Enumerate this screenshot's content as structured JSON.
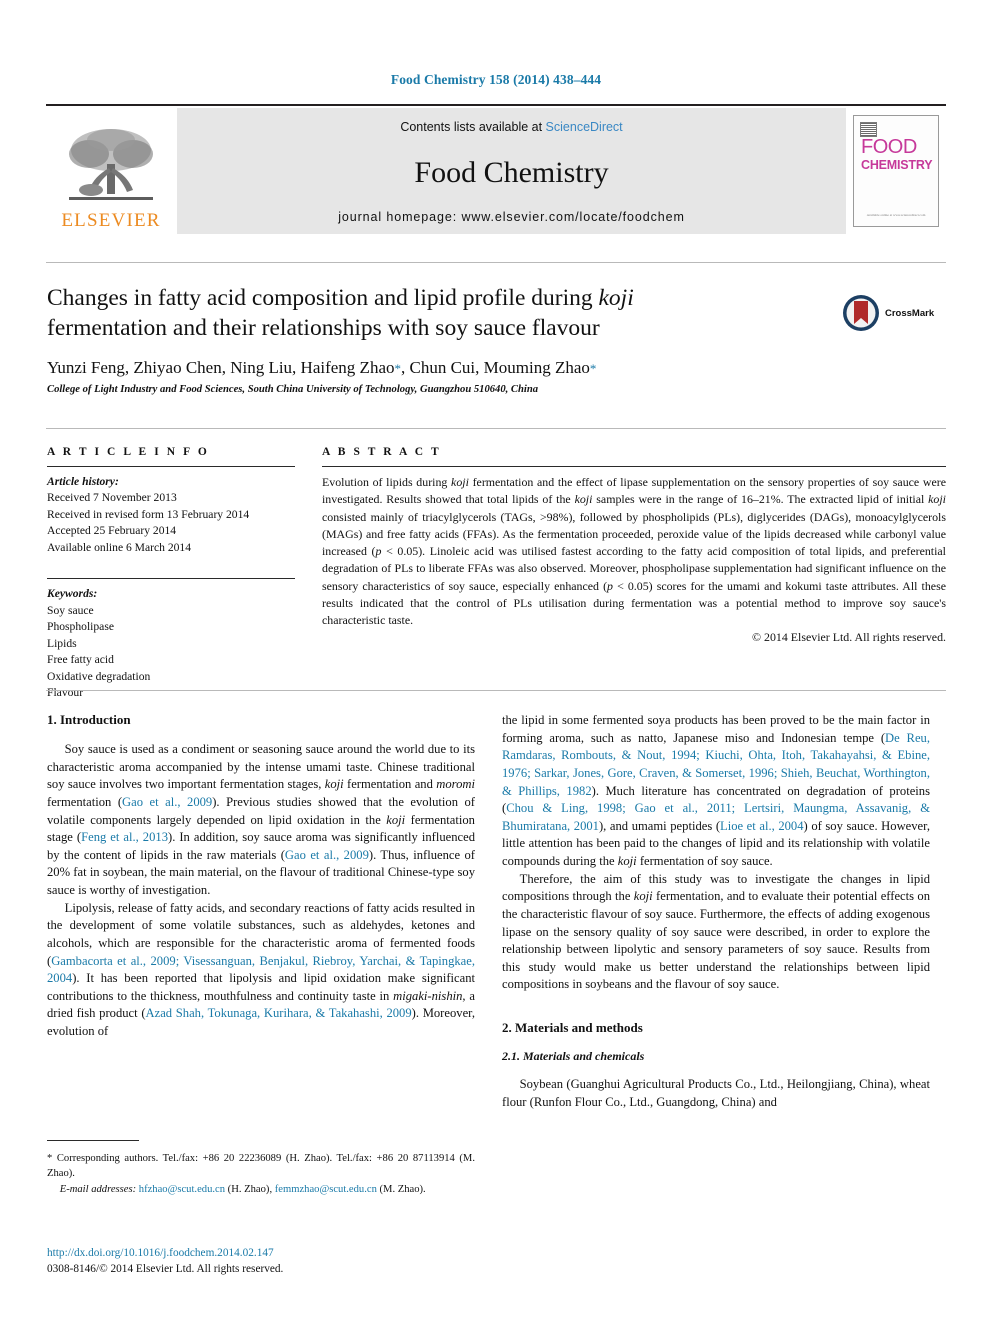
{
  "running_head": "Food Chemistry 158 (2014) 438–444",
  "masthead": {
    "contents_prefix": "Contents lists available at ",
    "sciencedirect": "ScienceDirect",
    "journal_title": "Food Chemistry",
    "homepage": "journal homepage: www.elsevier.com/locate/foodchem",
    "publisher_name": "ELSEVIER",
    "cover": {
      "line1": "FOOD",
      "line2": "CHEMISTRY",
      "footer": "Available online at www.sciencedirect.com"
    },
    "colors": {
      "link": "#3a88c4",
      "elsevier_orange": "#ec8b22",
      "cover_magenta": "#c6399a",
      "band_grey": "#e6e6e6"
    }
  },
  "article": {
    "title_line1": "Changes in fatty acid composition and lipid profile during ",
    "title_italic1": "koji",
    "title_line2": "fermentation and their relationships with soy sauce flavour",
    "authors": "Yunzi Feng, Zhiyao Chen, Ning Liu, Haifeng Zhao",
    "authors_cont": ", Chun Cui, Mouming Zhao",
    "corresponding_marker": "*",
    "affiliation": "College of Light Industry and Food Sciences, South China University of Technology, Guangzhou 510640, China",
    "crossmark_label": "CrossMark"
  },
  "article_info": {
    "heading": "A R T I C L E  I N F O",
    "history_label": "Article history:",
    "history": [
      "Received 7 November 2013",
      "Received in revised form 13 February 2014",
      "Accepted 25 February 2014",
      "Available online 6 March 2014"
    ],
    "keywords_label": "Keywords:",
    "keywords": [
      "Soy sauce",
      "Phospholipase",
      "Lipids",
      "Free fatty acid",
      "Oxidative degradation",
      "Flavour"
    ]
  },
  "abstract": {
    "heading": "A B S T R A C T",
    "part1": "Evolution of lipids during ",
    "italic1": "koji",
    "part2": " fermentation and the effect of lipase supplementation on the sensory properties of soy sauce were investigated. Results showed that total lipids of the ",
    "italic2": "koji",
    "part3": " samples were in the range of 16–21%. The extracted lipid of initial ",
    "italic3": "koji",
    "part4": " consisted mainly of triacylglycerols (TAGs, >98%), followed by phospholipids (PLs), diglycerides (DAGs), monoacylglycerols (MAGs) and free fatty acids (FFAs). As the fermentation proceeded, peroxide value of the lipids decreased while carbonyl value increased (",
    "italic4": "p",
    "part5": " < 0.05). Linoleic acid was utilised fastest according to the fatty acid composition of total lipids, and preferential degradation of PLs to liberate FFAs was also observed. Moreover, phospholipase supplementation had significant influence on the sensory characteristics of soy sauce, especially enhanced (",
    "italic5": "p",
    "part6": " < 0.05) scores for the umami and kokumi taste attributes. All these results indicated that the control of PLs utilisation during fermentation was a potential method to improve soy sauce's characteristic taste.",
    "copyright": "© 2014 Elsevier Ltd. All rights reserved."
  },
  "body": {
    "intro_heading": "1. Introduction",
    "left_p1_a": "Soy sauce is used as a condiment or seasoning sauce around the world due to its characteristic aroma accompanied by the intense umami taste. Chinese traditional soy sauce involves two important fermentation stages, ",
    "left_p1_it1": "koji",
    "left_p1_b": " fermentation and ",
    "left_p1_it2": "moromi",
    "left_p1_c": " fermentation (",
    "left_p1_cite1": "Gao et al., 2009",
    "left_p1_d": "). Previous studies showed that the evolution of volatile components largely depended on lipid oxidation in the ",
    "left_p1_it3": "koji",
    "left_p1_e": " fermentation stage (",
    "left_p1_cite2": "Feng et al., 2013",
    "left_p1_f": "). In addition, soy sauce aroma was significantly influenced by the content of lipids in the raw materials (",
    "left_p1_cite3": "Gao et al., 2009",
    "left_p1_g": "). Thus, influence of 20% fat in soybean, the main material, on the flavour of traditional Chinese-type soy sauce is worthy of investigation.",
    "left_p2_a": "Lipolysis, release of fatty acids, and secondary reactions of fatty acids resulted in the development of some volatile substances, such as aldehydes, ketones and alcohols, which are responsible for the characteristic aroma of fermented foods (",
    "left_p2_cite1": "Gambacorta et al., 2009; Visessanguan, Benjakul, Riebroy, Yarchai, & Tapingkae, 2004",
    "left_p2_b": "). It has been reported that lipolysis and lipid oxidation make significant contributions to the thickness, mouthfulness and continuity taste in ",
    "left_p2_it1": "migaki-nishin",
    "left_p2_c": ", a dried fish product (",
    "left_p2_cite2": "Azad Shah, Tokunaga, Kurihara, & Takahashi, 2009",
    "left_p2_d": "). Moreover, evolution of",
    "right_p1_a": "the lipid in some fermented soya products has been proved to be the main factor in forming aroma, such as natto, Japanese miso and Indonesian tempe (",
    "right_p1_cite1": "De Reu, Ramdaras, Rombouts, & Nout, 1994; Kiuchi, Ohta, Itoh, Takahayahsi, & Ebine, 1976; Sarkar, Jones, Gore, Craven, & Somerset, 1996; Shieh, Beuchat, Worthington, & Phillips, 1982",
    "right_p1_b": "). Much literature has concentrated on degradation of proteins (",
    "right_p1_cite2": "Chou & Ling, 1998; Gao et al., 2011; Lertsiri, Maungma, Assavanig, & Bhumiratana, 2001",
    "right_p1_c": "), and umami peptides (",
    "right_p1_cite3": "Lioe et al., 2004",
    "right_p1_d": ") of soy sauce. However, little attention has been paid to the changes of lipid and its relationship with volatile compounds during the ",
    "right_p1_it1": "koji",
    "right_p1_e": " fermentation of soy sauce.",
    "right_p2_a": "Therefore, the aim of this study was to investigate the changes in lipid compositions through the ",
    "right_p2_it1": "koji",
    "right_p2_b": " fermentation, and to evaluate their potential effects on the characteristic flavour of soy sauce. Furthermore, the effects of adding exogenous lipase on the sensory quality of soy sauce were described, in order to explore the relationship between lipolytic and sensory parameters of soy sauce. Results from this study would make us better understand the relationships between lipid compositions in soybeans and the flavour of soy sauce.",
    "methods_heading": "2. Materials and methods",
    "methods_sub_heading": "2.1. Materials and chemicals",
    "right_p3": "Soybean (Guanghui Agricultural Products Co., Ltd., Heilongjiang, China), wheat flour (Runfon Flour Co., Ltd., Guangdong, China) and"
  },
  "footnotes": {
    "corresponding": "* Corresponding authors. Tel./fax: +86 20 22236089 (H. Zhao). Tel./fax: +86 20 87113914 (M. Zhao).",
    "email_label": "E-mail addresses:",
    "email1": "hfzhao@scut.edu.cn",
    "email1_owner": " (H. Zhao), ",
    "email2": "femmzhao@scut.edu.cn",
    "email2_owner": " (M. Zhao).",
    "doi": "http://dx.doi.org/10.1016/j.foodchem.2014.02.147",
    "issn_line": "0308-8146/© 2014 Elsevier Ltd. All rights reserved."
  }
}
